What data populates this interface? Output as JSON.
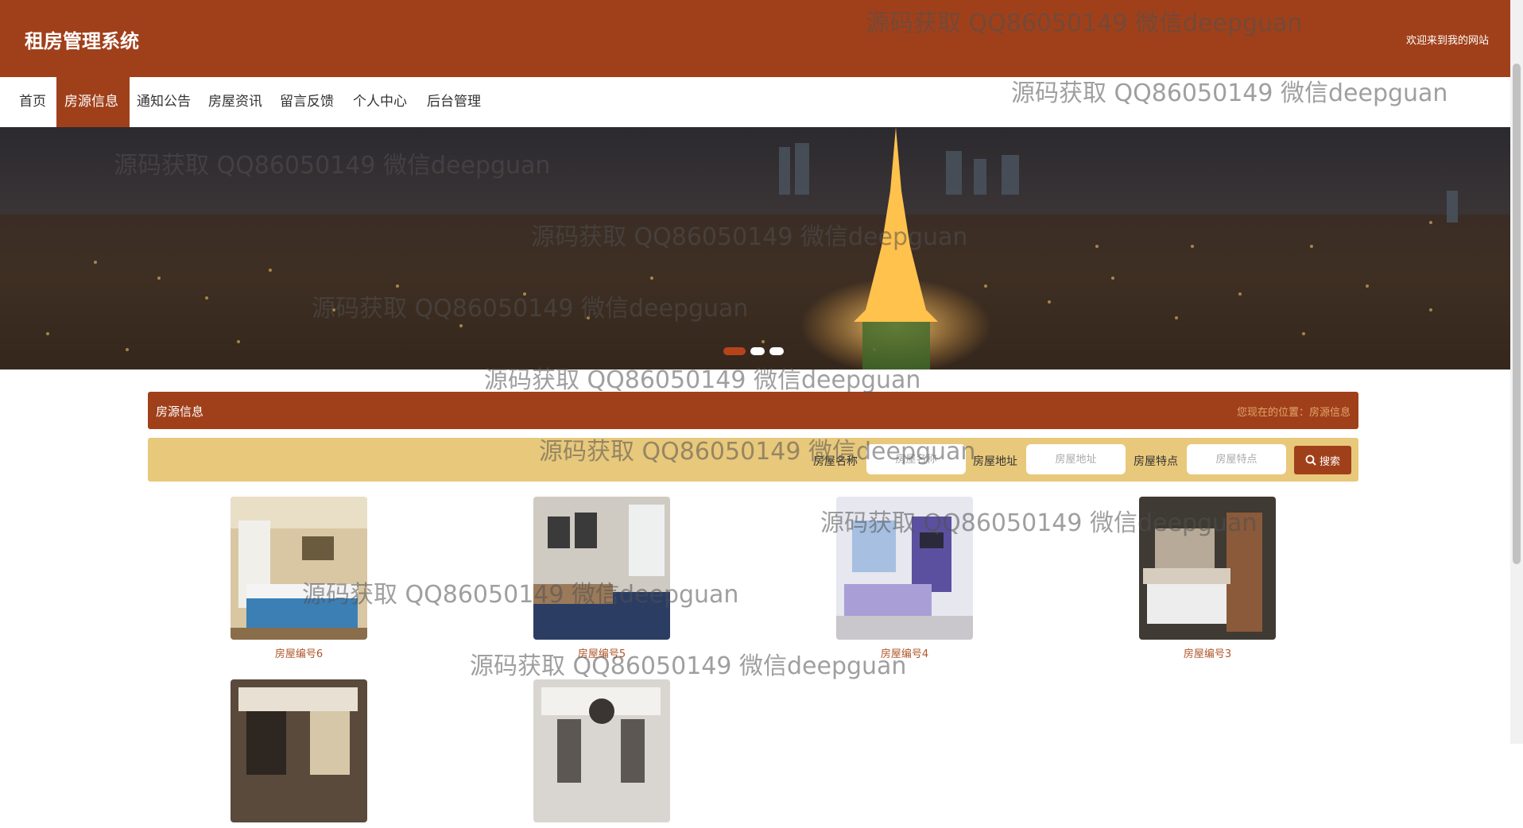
{
  "header": {
    "title": "租房管理系统",
    "welcome": "欢迎来到我的网站"
  },
  "nav": {
    "items": [
      "首页",
      "房源信息",
      "通知公告",
      "房屋资讯",
      "留言反馈",
      "个人中心",
      "后台管理"
    ],
    "active_index": 1
  },
  "banner": {
    "slides": 3,
    "active_slide": 0
  },
  "section": {
    "title": "房源信息",
    "breadcrumb": "您现在的位置：房源信息"
  },
  "search": {
    "name_label": "房屋名称",
    "name_placeholder": "房屋名称",
    "address_label": "房屋地址",
    "address_placeholder": "房屋地址",
    "feature_label": "房屋特点",
    "feature_placeholder": "房屋特点",
    "button_label": "搜索"
  },
  "listings": [
    {
      "caption": "房屋编号6"
    },
    {
      "caption": "房屋编号5"
    },
    {
      "caption": "房屋编号4"
    },
    {
      "caption": "房屋编号3"
    },
    {
      "caption": ""
    },
    {
      "caption": ""
    }
  ],
  "watermark": "源码获取 QQ86050149 微信deepguan",
  "colors": {
    "brand": "#a0401a",
    "search_bar": "#e8c87b",
    "breadcrumb": "#e3a36d"
  }
}
